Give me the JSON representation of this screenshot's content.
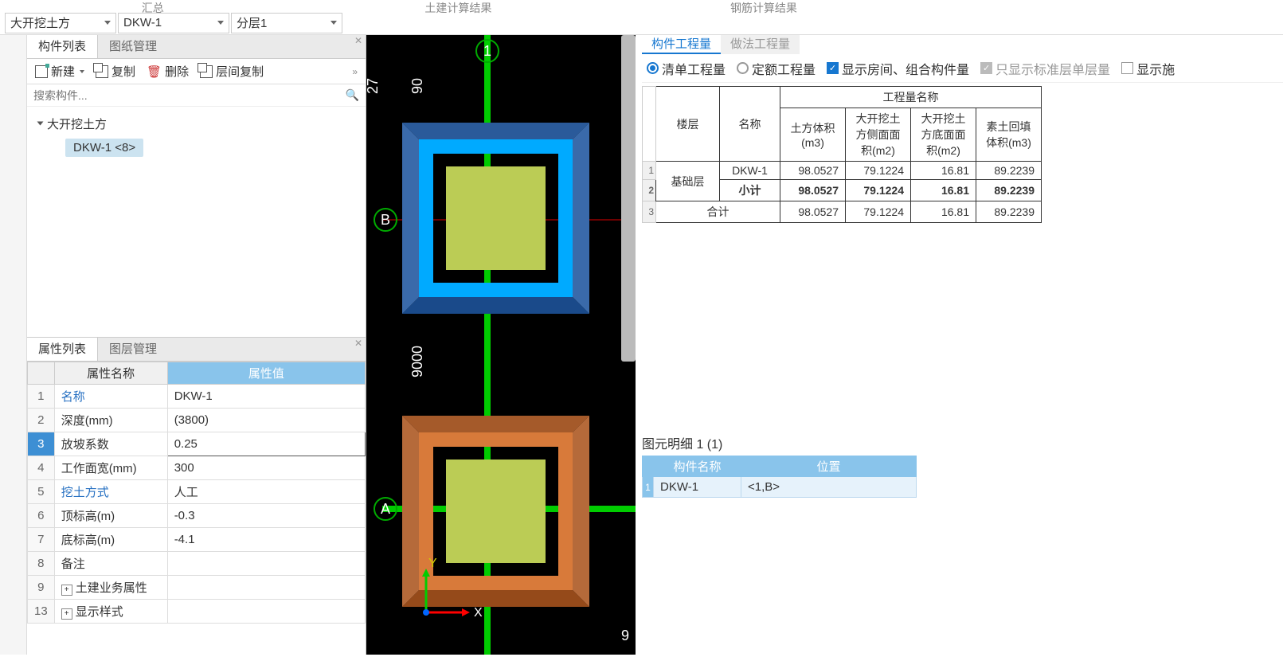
{
  "top_nav": [
    "汇总",
    "土建计算结果",
    "钢筋计算结果"
  ],
  "dropdowns": {
    "d1": "大开挖土方",
    "d2": "DKW-1",
    "d3": "分层1"
  },
  "left_tabs": {
    "comp_list": "构件列表",
    "drawing_mgmt": "图纸管理"
  },
  "toolbar": {
    "new": "新建",
    "copy": "复制",
    "del": "删除",
    "layer_copy": "层间复制"
  },
  "search_placeholder": "搜索构件...",
  "tree": {
    "root": "大开挖土方",
    "child": "DKW-1 <8>"
  },
  "prop_tabs": {
    "prop_list": "属性列表",
    "layer_mgmt": "图层管理"
  },
  "prop_headers": {
    "name": "属性名称",
    "value": "属性值"
  },
  "props": [
    {
      "n": "1",
      "name": "名称",
      "value": "DKW-1",
      "blue": true
    },
    {
      "n": "2",
      "name": "深度(mm)",
      "value": "(3800)"
    },
    {
      "n": "3",
      "name": "放坡系数",
      "value": "0.25",
      "sel": true,
      "editing": true
    },
    {
      "n": "4",
      "name": "工作面宽(mm)",
      "value": "300"
    },
    {
      "n": "5",
      "name": "挖土方式",
      "value": "人工",
      "blue": true
    },
    {
      "n": "6",
      "name": "顶标高(m)",
      "value": "-0.3"
    },
    {
      "n": "7",
      "name": "底标高(m)",
      "value": "-4.1"
    },
    {
      "n": "8",
      "name": "备注",
      "value": ""
    },
    {
      "n": "9",
      "name": "土建业务属性",
      "value": "",
      "expand": true
    },
    {
      "n": "13",
      "name": "显示样式",
      "value": "",
      "expand": true
    }
  ],
  "right_tabs": {
    "comp_qty": "构件工程量",
    "method_qty": "做法工程量"
  },
  "filters": {
    "list_qty": "清单工程量",
    "quota_qty": "定额工程量",
    "show_room": "显示房间、组合构件量",
    "show_single": "只显示标准层单层量",
    "show_sth": "显示施"
  },
  "qty_headers": {
    "floor": "楼层",
    "name": "名称",
    "qty_name": "工程量名称",
    "c1": "土方体积(m3)",
    "c2": "大开挖土方侧面面积(m2)",
    "c3": "大开挖土方底面面积(m2)",
    "c4": "素土回填体积(m3)"
  },
  "qty_rows": [
    {
      "rn": "1",
      "floor": "基础层",
      "name": "DKW-1",
      "v1": "98.0527",
      "v2": "79.1224",
      "v3": "16.81",
      "v4": "89.2239"
    },
    {
      "rn": "2",
      "floor": "",
      "name": "小计",
      "v1": "98.0527",
      "v2": "79.1224",
      "v3": "16.81",
      "v4": "89.2239",
      "bold": true
    },
    {
      "rn": "3",
      "floor": "合计",
      "name_merged": true,
      "v1": "98.0527",
      "v2": "79.1224",
      "v3": "16.81",
      "v4": "89.2239"
    }
  ],
  "details_label": "图元明细  1 (1)",
  "details_headers": {
    "name": "构件名称",
    "pos": "位置"
  },
  "details_rows": [
    {
      "rn": "1",
      "name": "DKW-1",
      "pos": "<1,B>"
    }
  ],
  "canvas": {
    "grid_labels": {
      "top_num": "1",
      "left_B": "B",
      "left_A": "A",
      "dim_90": "90",
      "dim_27": "27",
      "dim_9000": "9000",
      "dim_9": "9",
      "axis_x": "X",
      "axis_y": "Y"
    }
  }
}
